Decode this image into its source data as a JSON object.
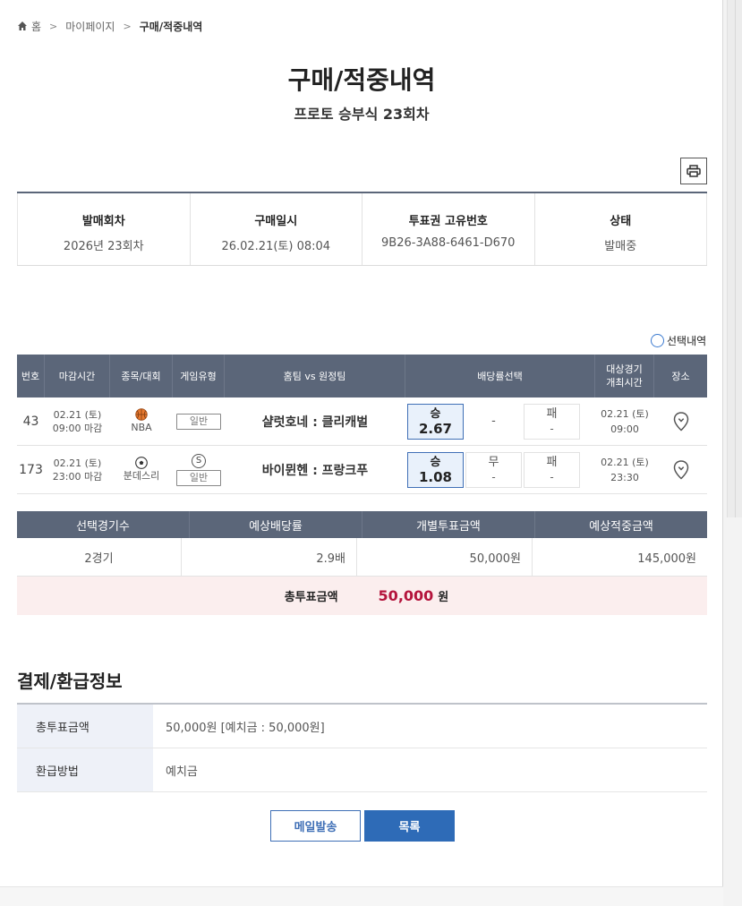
{
  "breadcrumb": {
    "home": "홈",
    "mypage": "마이페이지",
    "current": "구매/적중내역"
  },
  "title": "구매/적중내역",
  "subtitle": "프로토 승부식 23회차",
  "info": [
    {
      "label": "발매회차",
      "value": "2026년 23회차"
    },
    {
      "label": "구매일시",
      "value": "26.02.21(토) 08:04"
    },
    {
      "label": "투표권 고유번호",
      "value": "9B26-3A88-6461-D670"
    },
    {
      "label": "상태",
      "value": "발매중"
    }
  ],
  "selection_toggle": "선택내역",
  "game_table": {
    "headers": [
      "번호",
      "마감시간",
      "종목/대회",
      "게임유형",
      "홈팀 vs 원정팀",
      "배당률선택",
      "대상경기\n개최시간",
      "장소"
    ],
    "rows": [
      {
        "no": "43",
        "close_date": "02.21 (토)",
        "close_time": "09:00 마감",
        "sport_icon": "basketball-icon",
        "league": "NBA",
        "type": "일반",
        "teams": "샬럿호네 : 클리캐벌",
        "odds": [
          {
            "k": "승",
            "v": "2.67",
            "selected": true
          },
          {
            "k": "-",
            "v": "",
            "selected": false,
            "blank": true
          },
          {
            "k": "패",
            "v": "-",
            "selected": false
          }
        ],
        "game_date": "02.21 (토)",
        "game_time": "09:00"
      },
      {
        "no": "173",
        "close_date": "02.21 (토)",
        "close_time": "23:00 마감",
        "sport_icon": "soccer-ball-icon",
        "league": "분데스리",
        "type_badge": "S",
        "type": "일반",
        "teams": "바이뮌헨 : 프랑크푸",
        "odds": [
          {
            "k": "승",
            "v": "1.08",
            "selected": true
          },
          {
            "k": "무",
            "v": "-",
            "selected": false
          },
          {
            "k": "패",
            "v": "-",
            "selected": false
          }
        ],
        "game_date": "02.21 (토)",
        "game_time": "23:30"
      }
    ]
  },
  "summary": {
    "headers": [
      "선택경기수",
      "예상배당률",
      "개별투표금액",
      "예상적중금액"
    ],
    "values": [
      "2경기",
      "2.9배",
      "50,000원",
      "145,000원"
    ],
    "total_label": "총투표금액",
    "total_amount": "50,000",
    "total_unit": "원"
  },
  "payment": {
    "title": "결제/환급정보",
    "rows": [
      {
        "label": "총투표금액",
        "value": "50,000원 [예치금 : 50,000원]"
      },
      {
        "label": "환급방법",
        "value": "예치금"
      }
    ]
  },
  "buttons": {
    "mail": "메일발송",
    "list": "목록"
  }
}
